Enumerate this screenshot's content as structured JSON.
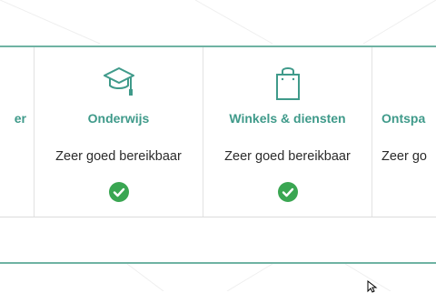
{
  "cards": [
    {
      "name": "partial-left",
      "title": "er",
      "status": "",
      "check": false
    },
    {
      "name": "onderwijs",
      "title": "Onderwijs",
      "status": "Zeer goed bereikbaar",
      "icon": "graduation-cap-icon",
      "check": true
    },
    {
      "name": "winkels",
      "title": "Winkels & diensten",
      "status": "Zeer goed bereikbaar",
      "icon": "shopping-bag-icon",
      "check": true
    },
    {
      "name": "ontspanning-partial",
      "title": "Ontspa",
      "status": "Zeer go",
      "check": false
    }
  ],
  "colors": {
    "accent": "#3f9a8a",
    "check": "#3aa652",
    "border": "#6fb3a3"
  }
}
